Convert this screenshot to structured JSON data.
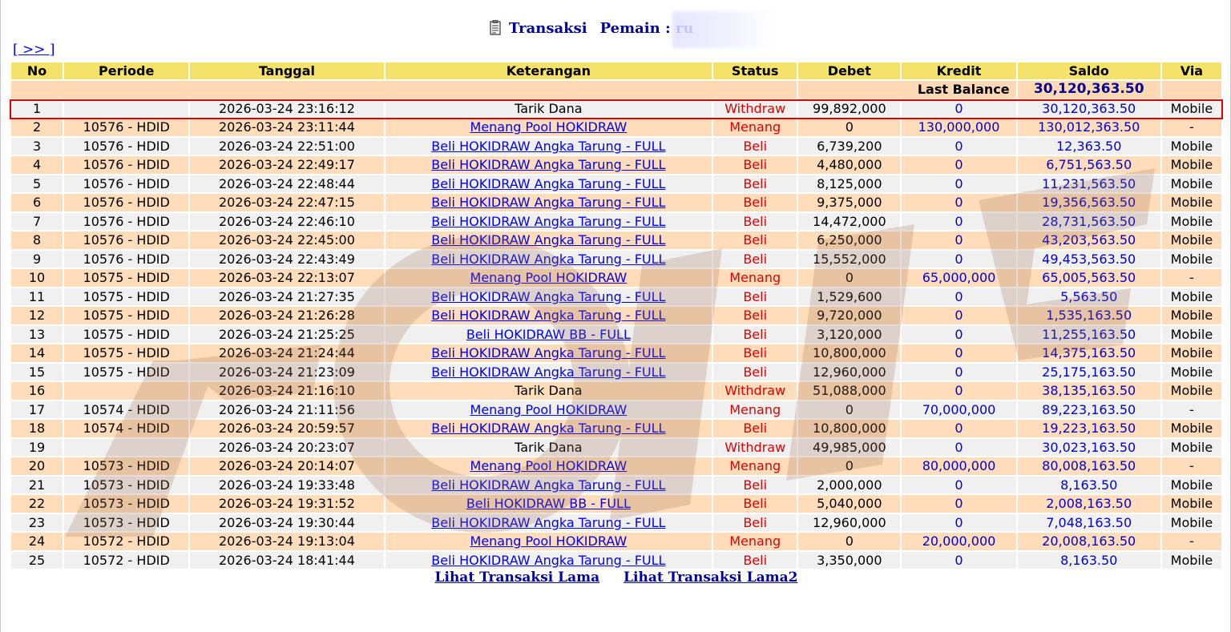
{
  "header": {
    "title_prefix": "Transaksi",
    "title_player_label": "Pemain : ru"
  },
  "nav": {
    "next_label": "[ >> ]"
  },
  "table": {
    "columns": [
      "No",
      "Periode",
      "Tanggal",
      "Keterangan",
      "Status",
      "Debet",
      "Kredit",
      "Saldo",
      "Via"
    ],
    "last_balance_label": "Last Balance",
    "last_balance_value": "30,120,363.50",
    "rows": [
      {
        "no": "1",
        "periode": "",
        "tanggal": "2026-03-24 23:16:12",
        "ket": "Tarik Dana",
        "link": false,
        "status": "Withdraw",
        "debet": "99,892,000",
        "kredit": "0",
        "saldo": "30,120,363.50",
        "via": "Mobile"
      },
      {
        "no": "2",
        "periode": "10576 - HDID",
        "tanggal": "2026-03-24 23:11:44",
        "ket": "Menang Pool HOKIDRAW",
        "link": true,
        "status": "Menang",
        "debet": "0",
        "kredit": "130,000,000",
        "saldo": "130,012,363.50",
        "via": "-"
      },
      {
        "no": "3",
        "periode": "10576 - HDID",
        "tanggal": "2026-03-24 22:51:00",
        "ket": "Beli HOKIDRAW Angka Tarung - FULL",
        "link": true,
        "status": "Beli",
        "debet": "6,739,200",
        "kredit": "0",
        "saldo": "12,363.50",
        "via": "Mobile"
      },
      {
        "no": "4",
        "periode": "10576 - HDID",
        "tanggal": "2026-03-24 22:49:17",
        "ket": "Beli HOKIDRAW Angka Tarung - FULL",
        "link": true,
        "status": "Beli",
        "debet": "4,480,000",
        "kredit": "0",
        "saldo": "6,751,563.50",
        "via": "Mobile"
      },
      {
        "no": "5",
        "periode": "10576 - HDID",
        "tanggal": "2026-03-24 22:48:44",
        "ket": "Beli HOKIDRAW Angka Tarung - FULL",
        "link": true,
        "status": "Beli",
        "debet": "8,125,000",
        "kredit": "0",
        "saldo": "11,231,563.50",
        "via": "Mobile"
      },
      {
        "no": "6",
        "periode": "10576 - HDID",
        "tanggal": "2026-03-24 22:47:15",
        "ket": "Beli HOKIDRAW Angka Tarung - FULL",
        "link": true,
        "status": "Beli",
        "debet": "9,375,000",
        "kredit": "0",
        "saldo": "19,356,563.50",
        "via": "Mobile"
      },
      {
        "no": "7",
        "periode": "10576 - HDID",
        "tanggal": "2026-03-24 22:46:10",
        "ket": "Beli HOKIDRAW Angka Tarung - FULL",
        "link": true,
        "status": "Beli",
        "debet": "14,472,000",
        "kredit": "0",
        "saldo": "28,731,563.50",
        "via": "Mobile"
      },
      {
        "no": "8",
        "periode": "10576 - HDID",
        "tanggal": "2026-03-24 22:45:00",
        "ket": "Beli HOKIDRAW Angka Tarung - FULL",
        "link": true,
        "status": "Beli",
        "debet": "6,250,000",
        "kredit": "0",
        "saldo": "43,203,563.50",
        "via": "Mobile"
      },
      {
        "no": "9",
        "periode": "10576 - HDID",
        "tanggal": "2026-03-24 22:43:49",
        "ket": "Beli HOKIDRAW Angka Tarung - FULL",
        "link": true,
        "status": "Beli",
        "debet": "15,552,000",
        "kredit": "0",
        "saldo": "49,453,563.50",
        "via": "Mobile"
      },
      {
        "no": "10",
        "periode": "10575 - HDID",
        "tanggal": "2026-03-24 22:13:07",
        "ket": "Menang Pool HOKIDRAW",
        "link": true,
        "status": "Menang",
        "debet": "0",
        "kredit": "65,000,000",
        "saldo": "65,005,563.50",
        "via": "-"
      },
      {
        "no": "11",
        "periode": "10575 - HDID",
        "tanggal": "2026-03-24 21:27:35",
        "ket": "Beli HOKIDRAW Angka Tarung - FULL",
        "link": true,
        "status": "Beli",
        "debet": "1,529,600",
        "kredit": "0",
        "saldo": "5,563.50",
        "via": "Mobile"
      },
      {
        "no": "12",
        "periode": "10575 - HDID",
        "tanggal": "2026-03-24 21:26:28",
        "ket": "Beli HOKIDRAW Angka Tarung - FULL",
        "link": true,
        "status": "Beli",
        "debet": "9,720,000",
        "kredit": "0",
        "saldo": "1,535,163.50",
        "via": "Mobile"
      },
      {
        "no": "13",
        "periode": "10575 - HDID",
        "tanggal": "2026-03-24 21:25:25",
        "ket": "Beli HOKIDRAW BB - FULL",
        "link": true,
        "status": "Beli",
        "debet": "3,120,000",
        "kredit": "0",
        "saldo": "11,255,163.50",
        "via": "Mobile"
      },
      {
        "no": "14",
        "periode": "10575 - HDID",
        "tanggal": "2026-03-24 21:24:44",
        "ket": "Beli HOKIDRAW Angka Tarung - FULL",
        "link": true,
        "status": "Beli",
        "debet": "10,800,000",
        "kredit": "0",
        "saldo": "14,375,163.50",
        "via": "Mobile"
      },
      {
        "no": "15",
        "periode": "10575 - HDID",
        "tanggal": "2026-03-24 21:23:09",
        "ket": "Beli HOKIDRAW Angka Tarung - FULL",
        "link": true,
        "status": "Beli",
        "debet": "12,960,000",
        "kredit": "0",
        "saldo": "25,175,163.50",
        "via": "Mobile"
      },
      {
        "no": "16",
        "periode": "",
        "tanggal": "2026-03-24 21:16:10",
        "ket": "Tarik Dana",
        "link": false,
        "status": "Withdraw",
        "debet": "51,088,000",
        "kredit": "0",
        "saldo": "38,135,163.50",
        "via": "Mobile"
      },
      {
        "no": "17",
        "periode": "10574 - HDID",
        "tanggal": "2026-03-24 21:11:56",
        "ket": "Menang Pool HOKIDRAW",
        "link": true,
        "status": "Menang",
        "debet": "0",
        "kredit": "70,000,000",
        "saldo": "89,223,163.50",
        "via": "-"
      },
      {
        "no": "18",
        "periode": "10574 - HDID",
        "tanggal": "2026-03-24 20:59:57",
        "ket": "Beli HOKIDRAW Angka Tarung - FULL",
        "link": true,
        "status": "Beli",
        "debet": "10,800,000",
        "kredit": "0",
        "saldo": "19,223,163.50",
        "via": "Mobile"
      },
      {
        "no": "19",
        "periode": "",
        "tanggal": "2026-03-24 20:23:07",
        "ket": "Tarik Dana",
        "link": false,
        "status": "Withdraw",
        "debet": "49,985,000",
        "kredit": "0",
        "saldo": "30,023,163.50",
        "via": "Mobile"
      },
      {
        "no": "20",
        "periode": "10573 - HDID",
        "tanggal": "2026-03-24 20:14:07",
        "ket": "Menang Pool HOKIDRAW",
        "link": true,
        "status": "Menang",
        "debet": "0",
        "kredit": "80,000,000",
        "saldo": "80,008,163.50",
        "via": "-"
      },
      {
        "no": "21",
        "periode": "10573 - HDID",
        "tanggal": "2026-03-24 19:33:48",
        "ket": "Beli HOKIDRAW Angka Tarung - FULL",
        "link": true,
        "status": "Beli",
        "debet": "2,000,000",
        "kredit": "0",
        "saldo": "8,163.50",
        "via": "Mobile"
      },
      {
        "no": "22",
        "periode": "10573 - HDID",
        "tanggal": "2026-03-24 19:31:52",
        "ket": "Beli HOKIDRAW BB - FULL",
        "link": true,
        "status": "Beli",
        "debet": "5,040,000",
        "kredit": "0",
        "saldo": "2,008,163.50",
        "via": "Mobile"
      },
      {
        "no": "23",
        "periode": "10573 - HDID",
        "tanggal": "2026-03-24 19:30:44",
        "ket": "Beli HOKIDRAW Angka Tarung - FULL",
        "link": true,
        "status": "Beli",
        "debet": "12,960,000",
        "kredit": "0",
        "saldo": "7,048,163.50",
        "via": "Mobile"
      },
      {
        "no": "24",
        "periode": "10572 - HDID",
        "tanggal": "2026-03-24 19:13:04",
        "ket": "Menang Pool HOKIDRAW",
        "link": true,
        "status": "Menang",
        "debet": "0",
        "kredit": "20,000,000",
        "saldo": "20,008,163.50",
        "via": "-"
      },
      {
        "no": "25",
        "periode": "10572 - HDID",
        "tanggal": "2026-03-24 18:41:44",
        "ket": "Beli HOKIDRAW Angka Tarung - FULL",
        "link": true,
        "status": "Beli",
        "debet": "3,350,000",
        "kredit": "0",
        "saldo": "8,163.50",
        "via": "Mobile"
      }
    ]
  },
  "footer": {
    "old_tx_label": "Lihat Transaksi Lama",
    "old_tx2_label": "Lihat Transaksi Lama2"
  },
  "colors": {
    "header_bg": "#f4e26a",
    "row_even": "#f0f0f0",
    "row_odd": "#ffddbb",
    "status_red": "#dd0000",
    "amount_blue": "#0000cc",
    "title_navy": "#000099",
    "highlight_red": "#e00000"
  },
  "icons": {
    "title_icon": "document-icon"
  }
}
